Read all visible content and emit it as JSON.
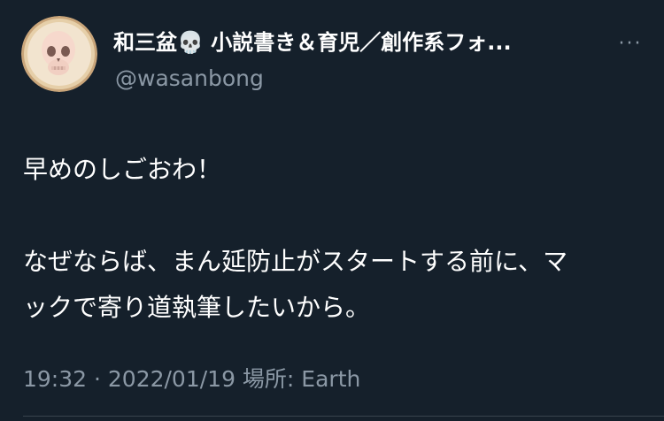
{
  "header": {
    "display_name": "和三盆💀 小説書き＆育児／創作系フォ...",
    "handle": "@wasanbong",
    "more_label": "···"
  },
  "body": {
    "line1": "早めのしごおわ！",
    "line2": "なぜならば、まん延防止がスタートする前に、マ",
    "line3": "ックで寄り道執筆したいから。"
  },
  "meta": {
    "text": "19:32 · 2022/01/19 場所: Earth"
  },
  "icons": {
    "avatar": "skull-avatar",
    "more": "more-icon"
  },
  "colors": {
    "background": "#15202b",
    "text": "#ffffff",
    "secondary": "#8b98a5",
    "divider": "#38444d"
  }
}
